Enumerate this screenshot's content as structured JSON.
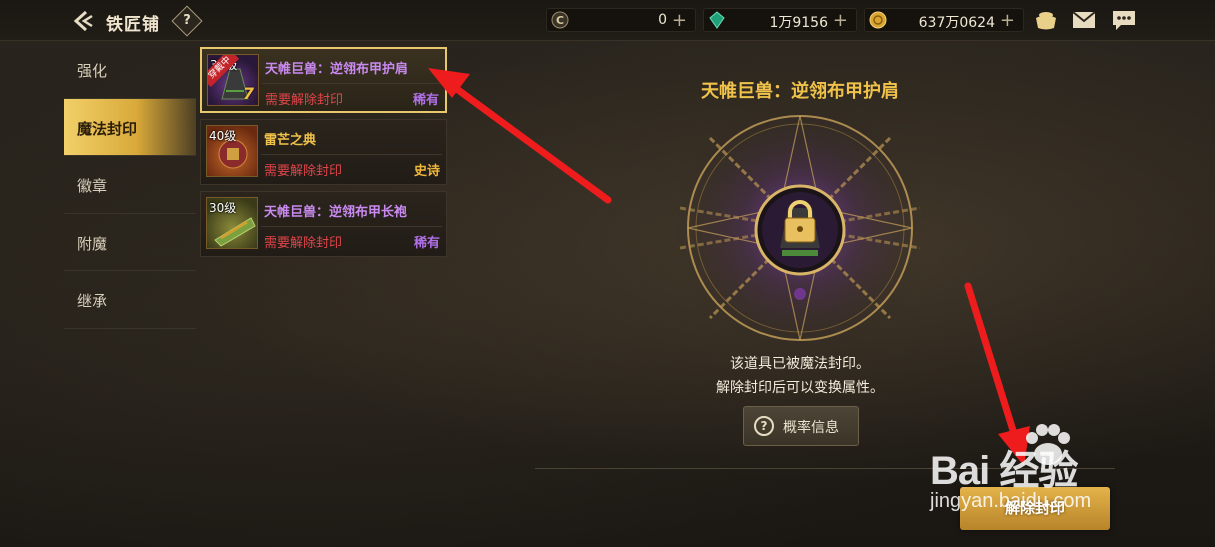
{
  "header": {
    "title": "铁匠铺",
    "help_label": "?"
  },
  "currencies": [
    {
      "icon": "coin-c-icon",
      "value": "0",
      "plus": "+"
    },
    {
      "icon": "green-gem-icon",
      "value": "1万9156",
      "plus": "+"
    },
    {
      "icon": "gold-coin-icon",
      "value": "637万0624",
      "plus": "+"
    }
  ],
  "top_icons": [
    "pot-icon",
    "mail-icon",
    "chat-icon"
  ],
  "sidebar": {
    "items": [
      {
        "label": "强化",
        "active": false
      },
      {
        "label": "魔法封印",
        "active": true
      },
      {
        "label": "徽章",
        "active": false
      },
      {
        "label": "附魔",
        "active": false
      },
      {
        "label": "继承",
        "active": false
      }
    ]
  },
  "items": [
    {
      "level": "30级",
      "name": "天帷巨兽：逆翎布甲护肩",
      "requirement": "需要解除封印",
      "rarity": "稀有",
      "equipped_tag": "穿戴中",
      "rarity_color": "#b070e8",
      "name_color": "#c98af0",
      "selected": true,
      "corner_number": "7"
    },
    {
      "level": "40级",
      "name": "雷芒之典",
      "requirement": "需要解除封印",
      "rarity": "史诗",
      "rarity_color": "#f0b83a",
      "name_color": "#f0c24a",
      "selected": false
    },
    {
      "level": "30级",
      "name": "天帷巨兽：逆翎布甲长袍",
      "requirement": "需要解除封印",
      "rarity": "稀有",
      "rarity_color": "#b070e8",
      "name_color": "#c98af0",
      "selected": false
    }
  ],
  "detail": {
    "title": "天帷巨兽：逆翎布甲护肩",
    "desc_line1": "该道具已被魔法封印。",
    "desc_line2": "解除封印后可以变换属性。",
    "prob_button": "概率信息",
    "unseal_button": "解除封印"
  },
  "watermark": {
    "main": "Bai 经验",
    "sub": "jingyan.baidu.com"
  }
}
